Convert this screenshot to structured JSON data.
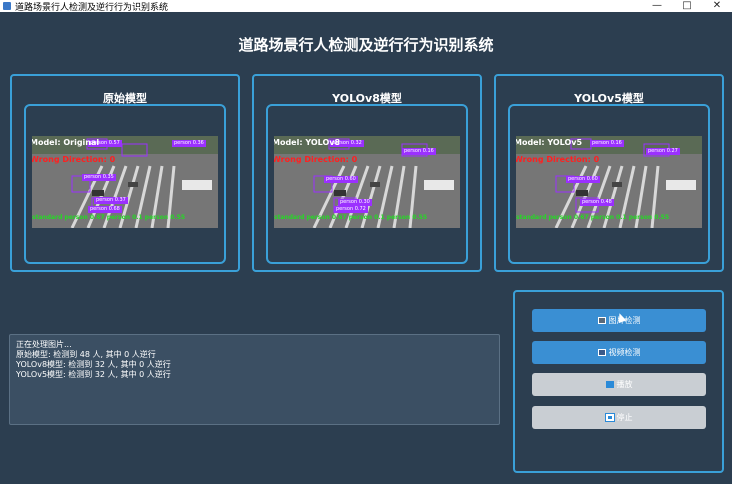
{
  "window": {
    "title": "道路场景行人检测及逆行行为识别系统",
    "minimize_icon": "minimize-icon",
    "maximize_icon": "maximize-icon",
    "close_icon": "close-icon"
  },
  "main_title": "道路场景行人检测及逆行行为识别系统",
  "panels": [
    {
      "title": "原始模型",
      "overlay_model": "Model: Original",
      "overlay_wrong": "Wrong Direction: 0",
      "overlay_bottom": "standard  person 0.67  person 0.1  person 0.55"
    },
    {
      "title": "YOLOv8模型",
      "overlay_model": "Model: YOLOv8",
      "overlay_wrong": "Wrong Direction: 0",
      "overlay_bottom": "standard  person 0.67  person 0.1  person 0.55"
    },
    {
      "title": "YOLOv5模型",
      "overlay_model": "Model: YOLOv5",
      "overlay_wrong": "Wrong Direction: 0",
      "overlay_bottom": "standard  person 0.67  person 0.1  person 0.55"
    }
  ],
  "log": {
    "lines": [
      "正在处理图片...",
      "原始模型: 检测到 48 人, 其中 0 人逆行",
      "YOLOv8模型: 检测到 32 人, 其中 0 人逆行",
      "YOLOv5模型: 检测到 32 人, 其中 0 人逆行"
    ]
  },
  "controls": {
    "image_detect": "图片检测",
    "video_detect": "视频检测",
    "play": "播放",
    "stop": "停止"
  },
  "colors": {
    "background": "#2c3e50",
    "accent_border": "#3aa0d8",
    "button_blue": "#3a8fd3",
    "button_gray": "#c9ced3",
    "detection_box": "#9b30ff"
  }
}
